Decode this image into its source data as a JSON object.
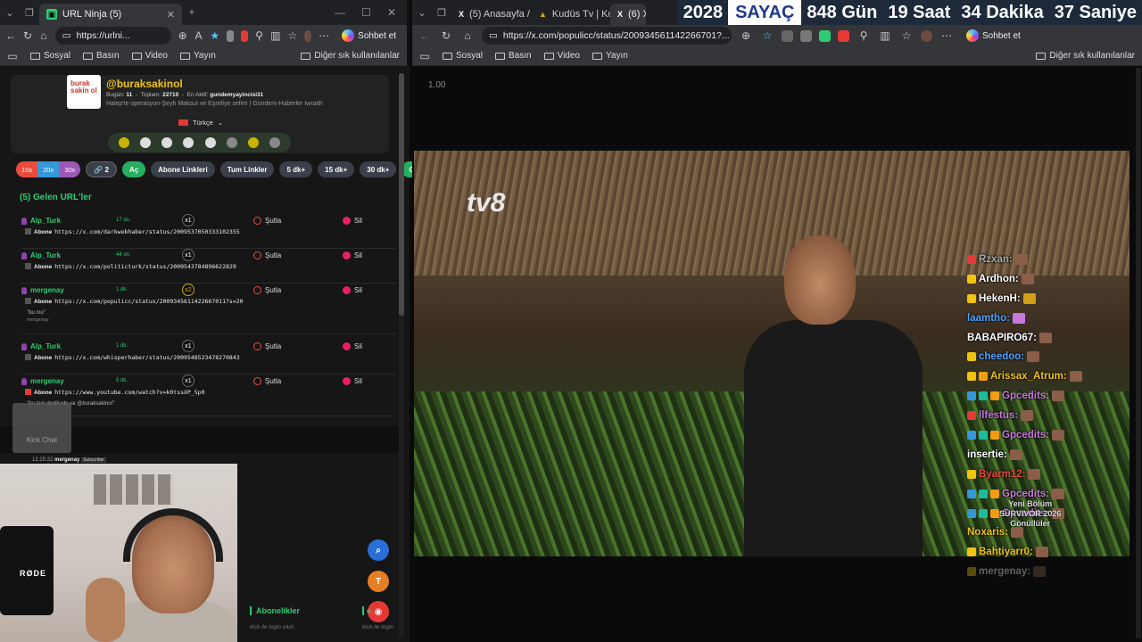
{
  "left_window": {
    "tab_title": "URL Ninja (5)",
    "url": "https://urlni...",
    "sohbet": "Sohbet et",
    "bookmarks": [
      "Sosyal",
      "Basın",
      "Video",
      "Yayın"
    ],
    "bookmarks_right": "Diğer sık kullanılanlar",
    "profile": {
      "handle": "@buraksakinol",
      "stats_bugun_label": "Bugün:",
      "stats_bugun": "11",
      "stats_toplam_label": "Toplam:",
      "stats_toplam": "22710",
      "stats_aktif_label": "En Aktif:",
      "stats_aktif": "gundemyayincisi31",
      "description": "Halep'te operasyon-Şeyh Maksut ve Eşrefiye seferi | Gündem-Haberler Iwraith",
      "language": "Türkçe",
      "logo_text": "burak sakin ol"
    },
    "speed_buttons": [
      "10x",
      "20x",
      "30x"
    ],
    "link_count": "2",
    "buttons": {
      "ac": "Aç",
      "abone": "Abone Linkleri",
      "tum": "Tum Linkler",
      "d5": "5 dk+",
      "d15": "15 dk+",
      "d30": "30 dk+",
      "guven": "Güven"
    },
    "gelen_title": "(5) Gelen URL'ler",
    "rows": [
      {
        "user": "Alp_Turk",
        "time": "17 sn.",
        "badge": "x1",
        "prefix": "Abone",
        "url": "https://x.com/darkwebhaber/status/2009537050333102355",
        "sutla": "Şutla",
        "sil": "Sil"
      },
      {
        "user": "Alp_Turk",
        "time": "44 sn.",
        "badge": "x1",
        "prefix": "Abone",
        "url": "https://x.com/politicturk/status/2009543784896622829",
        "sutla": "Şutla",
        "sil": "Sil"
      },
      {
        "user": "mergenay",
        "time": "1 dk.",
        "badge": "x2",
        "prefix": "Abone",
        "url": "https://x.com/populicc/status/2009345611422667011?s=20",
        "msg": "\"bu mu\"",
        "who": "mergenay",
        "sutla": "Şutla",
        "sil": "Sil"
      },
      {
        "user": "Alp_Turk",
        "time": "1 dk.",
        "badge": "x1",
        "prefix": "Abone",
        "url": "https://x.com/whisperhaber/status/2009548523478270843",
        "sutla": "Şutla",
        "sil": "Sil"
      },
      {
        "user": "mergenay",
        "time": "5 dk.",
        "badge": "x1",
        "prefix": "Abone",
        "url": "https://www.youtube.com/watch?v=k0tssXP_5p0",
        "msg": "\"bu tam dedikodu ya @buraksakinol\"",
        "sutla": "Şutla",
        "sil": "Sil"
      }
    ],
    "kick_chat": "Kick Chat",
    "chat_time": "12:25:22",
    "chat_user": "mergenay",
    "chat_sub": "Subscriber",
    "rode": "RØDE",
    "aboneler": "Abonelikler",
    "aboneler2": "e",
    "login1": "kick ile login olun.",
    "login2": "kick ile login"
  },
  "right_window": {
    "tabs": [
      "(5) Anasayfa /",
      "Kudüs Tv | Ku",
      "(6) X"
    ],
    "url": "https://x.com/populicc/status/200934561142266701?...",
    "sohbet": "Sohbet et",
    "bookmarks": [
      "Sosyal",
      "Basın",
      "Video",
      "Yayın"
    ],
    "bookmarks_right": "Diğer sık kullanılanlar",
    "counter": {
      "year": "2028",
      "label": "SAYAÇ",
      "gun": "848 Gün",
      "saat": "19 Saat",
      "dakika": "34 Dakika",
      "saniye": "37 Saniye"
    },
    "ratio": "1.00",
    "tv_logo": "tv8",
    "chat": [
      "Rzxan:",
      "Ardhon:",
      "HekenH:",
      "laamtho:",
      "BABAPIRO67:",
      "cheedoo:",
      "Arissax_Atrum:",
      "Gpcedits:",
      "llfestus:",
      "Gpcedits:",
      "insertie:",
      "Byarm12:",
      "Gpcedits:",
      "Gpcedits:",
      "Noxaris:",
      "Bahtiyarr0:",
      "mergenay:"
    ],
    "overlay": [
      "Yeni Bölüm",
      "SURVIVOR 2026",
      "Gönüllüler"
    ]
  }
}
